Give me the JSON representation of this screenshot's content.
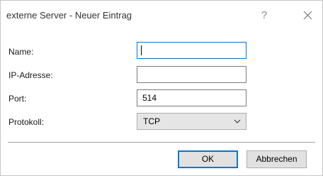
{
  "window": {
    "title": "externe Server - Neuer Eintrag",
    "help_label": "?"
  },
  "form": {
    "name": {
      "label": "Name:",
      "value": ""
    },
    "ip": {
      "label": "IP-Adresse:",
      "value": ""
    },
    "port": {
      "label": "Port:",
      "value": "514"
    },
    "protocol": {
      "label": "Protokoll:",
      "value": "TCP"
    }
  },
  "buttons": {
    "ok_label": "OK",
    "cancel_label": "Abbrechen"
  },
  "colors": {
    "focus_accent": "#0078d7",
    "button_face": "#e1e1e1"
  }
}
